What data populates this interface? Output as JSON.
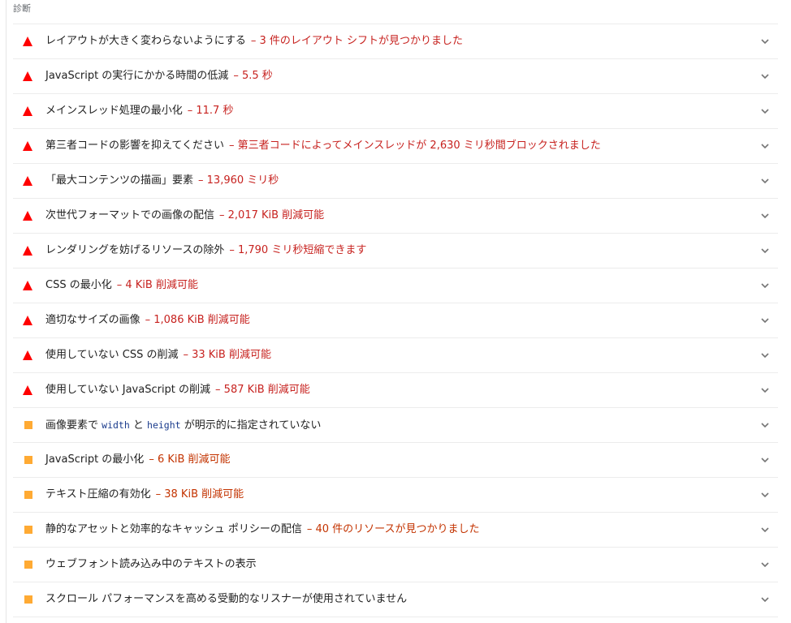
{
  "section": {
    "title": "診断"
  },
  "colors": {
    "fail": "#ff0000",
    "fail_text": "#c7221f",
    "average": "#ffaa33",
    "average_text": "#c33300"
  },
  "audits": [
    {
      "status": "fail",
      "title": "レイアウトが大きく変わらないようにする",
      "value": "– 3 件のレイアウト シフトが見つかりました"
    },
    {
      "status": "fail",
      "title": "JavaScript の実行にかかる時間の低減",
      "value": "– 5.5 秒"
    },
    {
      "status": "fail",
      "title": "メインスレッド処理の最小化",
      "value": "– 11.7 秒"
    },
    {
      "status": "fail",
      "title": "第三者コードの影響を抑えてください",
      "value": "– 第三者コードによってメインスレッドが 2,630 ミリ秒間ブロックされました"
    },
    {
      "status": "fail",
      "title": "「最大コンテンツの描画」要素",
      "value": "– 13,960 ミリ秒"
    },
    {
      "status": "fail",
      "title": "次世代フォーマットでの画像の配信",
      "value": "– 2,017 KiB 削減可能"
    },
    {
      "status": "fail",
      "title": "レンダリングを妨げるリソースの除外",
      "value": "– 1,790 ミリ秒短縮できます"
    },
    {
      "status": "fail",
      "title": "CSS の最小化",
      "value": "– 4 KiB 削減可能"
    },
    {
      "status": "fail",
      "title": "適切なサイズの画像",
      "value": "– 1,086 KiB 削減可能"
    },
    {
      "status": "fail",
      "title": "使用していない CSS の削減",
      "value": "– 33 KiB 削減可能"
    },
    {
      "status": "fail",
      "title": "使用していない JavaScript の削減",
      "value": "– 587 KiB 削減可能"
    },
    {
      "status": "average",
      "title_pre": "画像要素で ",
      "code1": "width",
      "title_mid": " と ",
      "code2": "height",
      "title_post": " が明示的に指定されていない",
      "value": ""
    },
    {
      "status": "average",
      "title": "JavaScript の最小化",
      "value": "– 6 KiB 削減可能"
    },
    {
      "status": "average",
      "title": "テキスト圧縮の有効化",
      "value": "– 38 KiB 削減可能"
    },
    {
      "status": "average",
      "title": "静的なアセットと効率的なキャッシュ ポリシーの配信",
      "value": "– 40 件のリソースが見つかりました"
    },
    {
      "status": "average",
      "title": "ウェブフォント読み込み中のテキストの表示",
      "value": ""
    },
    {
      "status": "average",
      "title": "スクロール パフォーマンスを高める受動的なリスナーが使用されていません",
      "value": ""
    }
  ]
}
